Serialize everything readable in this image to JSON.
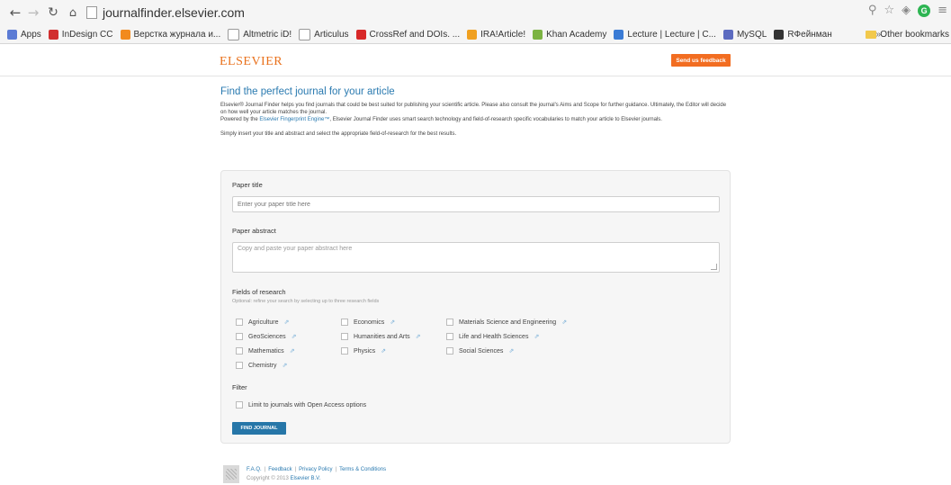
{
  "browser": {
    "url": "journalfinder.elsevier.com",
    "bookmarks": [
      {
        "label": "Apps",
        "color": "#5b7bd5"
      },
      {
        "label": "InDesign CC",
        "color": "#d12f2f"
      },
      {
        "label": "Верстка журнала и...",
        "color": "#f28a1d"
      },
      {
        "label": "Altmetric iD!",
        "color": "#ffffff"
      },
      {
        "label": "Articulus",
        "color": "#ffffff"
      },
      {
        "label": "CrossRef and DOIs. ...",
        "color": "#d82828"
      },
      {
        "label": "IRA!Article!",
        "color": "#f0a020"
      },
      {
        "label": "Khan Academy",
        "color": "#7cb342"
      },
      {
        "label": "Lecture | Lecture | C...",
        "color": "#3a7bd5"
      },
      {
        "label": "MySQL",
        "color": "#5c6bc0"
      },
      {
        "label": "RФейнман",
        "color": "#333333"
      }
    ],
    "more": "»",
    "other_bookmarks": "Other bookmarks"
  },
  "header": {
    "logo": "ELSEVIER",
    "feedback": "Send us feedback"
  },
  "main": {
    "title": "Find the perfect journal for your article",
    "intro_1": "Elsevier® Journal Finder helps you find journals that could be best suited for publishing your scientific article. Please also consult the journal's Aims and Scope for further guidance. Ultimately, the Editor will decide on how well your article matches the journal.",
    "intro_2_prefix": "Powered by the ",
    "intro_2_link": "Elsevier Fingerprint Engine™",
    "intro_2_suffix": ", Elsevier Journal Finder uses smart search technology and field-of-research specific vocabularies to match your article to Elsevier journals.",
    "intro_3": "Simply insert your title and abstract and select the appropriate field-of-research for the best results."
  },
  "form": {
    "paper_title_label": "Paper title",
    "paper_title_placeholder": "Enter your paper title here",
    "abstract_label": "Paper abstract",
    "abstract_placeholder": "Copy and paste your paper abstract here",
    "fields_label": "Fields of research",
    "fields_hint": "Optional: refine your search by selecting up to three research fields",
    "fields": [
      "Agriculture",
      "Economics",
      "Materials Science and Engineering",
      "GeoSciences",
      "Humanities and Arts",
      "Life and Health Sciences",
      "Mathematics",
      "Physics",
      "Social Sciences",
      "Chemistry"
    ],
    "filter_label": "Filter",
    "open_access_label": "Limit to journals with Open Access options",
    "find_button": "FIND JOURNAL"
  },
  "footer": {
    "links": [
      "F.A.Q.",
      "Feedback",
      "Privacy Policy",
      "Terms & Conditions"
    ],
    "copyright_prefix": "Copyright © 2013 ",
    "copyright_link": "Elsevier B.V."
  },
  "colors": {
    "accent": "#2a7ab0",
    "brand": "#e9711c",
    "feedback_button": "#f26d21",
    "find_button": "#2676a8"
  }
}
